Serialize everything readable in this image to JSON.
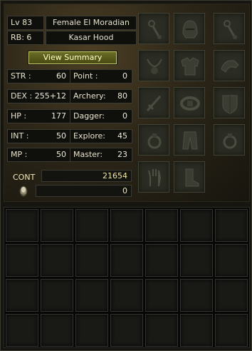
{
  "header": {
    "level": "Lv 83",
    "name": "Female El Moradian",
    "rebirth": "RB: 6",
    "title": "Kasar Hood"
  },
  "summary_button": "View Summary",
  "stats_left": [
    {
      "label": "STR :",
      "value": "60"
    },
    {
      "label": "DEX :",
      "value": "255+12"
    },
    {
      "label": "HP :",
      "value": "177"
    },
    {
      "label": "INT :",
      "value": "50"
    },
    {
      "label": "MP :",
      "value": "50"
    }
  ],
  "stats_right": [
    {
      "label": "Point :",
      "value": "0"
    },
    {
      "label": "Archery:",
      "value": "80"
    },
    {
      "label": "Dagger:",
      "value": "0"
    },
    {
      "label": "Explore:",
      "value": "45"
    },
    {
      "label": "Master:",
      "value": "23"
    }
  ],
  "cont_label": "CONT",
  "cont_value": "21654",
  "gold_value": "0",
  "equipment": [
    {
      "slot": "earring-left",
      "icon": "earring-icon"
    },
    {
      "slot": "helmet",
      "icon": "helmet-icon"
    },
    {
      "slot": "earring-right",
      "icon": "earring-icon"
    },
    {
      "slot": "necklace",
      "icon": "necklace-icon"
    },
    {
      "slot": "armor",
      "icon": "armor-icon"
    },
    {
      "slot": "pauldron",
      "icon": "pauldron-icon"
    },
    {
      "slot": "weapon-left",
      "icon": "weapon-icon"
    },
    {
      "slot": "belt",
      "icon": "belt-icon"
    },
    {
      "slot": "shield",
      "icon": "shield-icon"
    },
    {
      "slot": "ring-left",
      "icon": "ring-icon"
    },
    {
      "slot": "pants",
      "icon": "pants-icon"
    },
    {
      "slot": "ring-right",
      "icon": "ring-icon"
    },
    {
      "slot": "gloves",
      "icon": "gloves-icon"
    },
    {
      "slot": "boots",
      "icon": "boots-icon"
    }
  ],
  "inventory": {
    "rows": 4,
    "cols": 7
  },
  "colors": {
    "gold_text": "#f6e7a4",
    "panel_bg": "#2c2618",
    "button": "#5a5c1c"
  }
}
